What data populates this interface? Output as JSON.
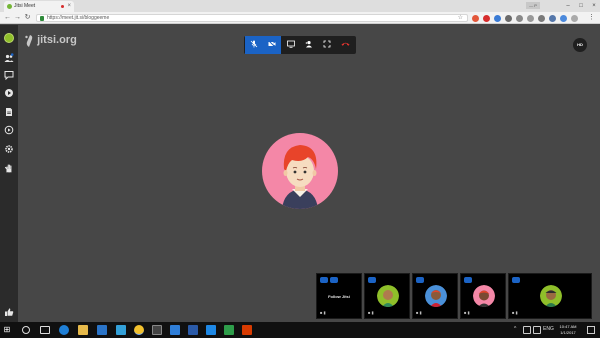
{
  "browser": {
    "tab_title": "Jitsi Meet",
    "tab_close": "×",
    "profile_label": "— P",
    "window_controls": [
      "–",
      "□",
      "×"
    ],
    "url": "https://meet.jit.si/bloggeeme",
    "nav": {
      "back": "←",
      "forward": "→",
      "reload": "↻"
    },
    "star": "☆"
  },
  "jitsi": {
    "logo_text": "jitsi.org",
    "sidebar_icons": [
      "avatar",
      "participants-icon",
      "chat-icon",
      "share-video-icon",
      "document-icon",
      "play-icon",
      "settings-icon",
      "raise-hand-icon"
    ],
    "feedback_icon": "thumbs-up-icon",
    "toolbar": {
      "mute_label": "🎤",
      "camera_label": "■",
      "screen_label": "▭",
      "invite_label": "☺",
      "fullscreen_label": "⛶",
      "hangup_label": "☎"
    },
    "quality_label": "HD",
    "filmstrip": {
      "follow_label": "Follow Jitsi",
      "thumb_status": "■ ▮"
    }
  },
  "taskbar": {
    "start_label": "⊞",
    "lang": "ENG",
    "time": "10:47 AM",
    "date": "1/1/2017",
    "chevron": "^"
  },
  "colors": {
    "accent": "#1b63c5",
    "hangup": "#e0342f",
    "avatar_bg": "#f487a7",
    "avatar_hair": "#e8442a"
  }
}
